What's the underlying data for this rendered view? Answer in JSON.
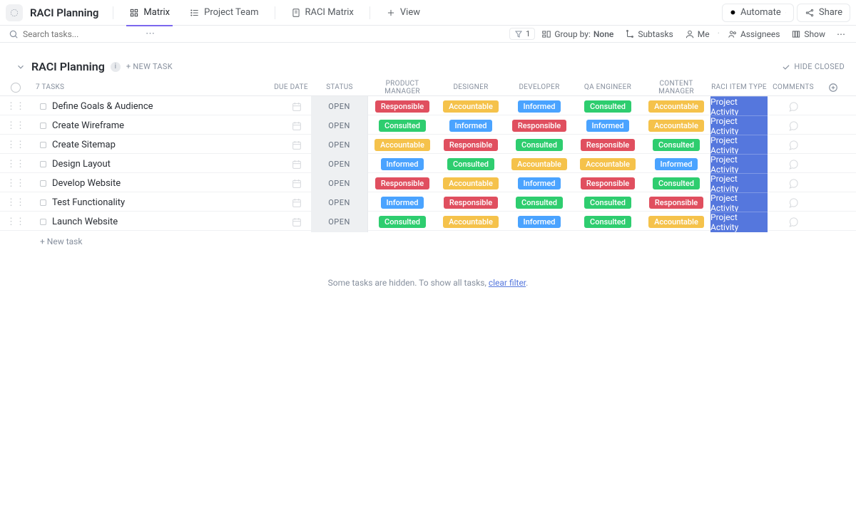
{
  "header": {
    "title": "RACI Planning",
    "tabs": [
      {
        "label": "Matrix",
        "icon": "matrix"
      },
      {
        "label": "Project Team",
        "icon": "team"
      },
      {
        "label": "RACI Matrix",
        "icon": "doc"
      }
    ],
    "view_label": "View",
    "automate_label": "Automate",
    "share_label": "Share"
  },
  "toolbar": {
    "search_placeholder": "Search tasks...",
    "filter_count": "1",
    "group_by_label": "Group by:",
    "group_by_value": "None",
    "subtasks": "Subtasks",
    "me": "Me",
    "assignees": "Assignees",
    "show": "Show"
  },
  "group": {
    "title": "RACI Planning",
    "new_task_label": "+ NEW TASK",
    "hide_closed": "HIDE CLOSED",
    "count_label": "7 TASKS"
  },
  "columns": [
    "DUE DATE",
    "STATUS",
    "PRODUCT MANAGER",
    "DESIGNER",
    "DEVELOPER",
    "QA ENGINEER",
    "CONTENT MANAGER",
    "RACI ITEM TYPE",
    "COMMENTS"
  ],
  "rows": [
    {
      "name": "Define Goals & Audience",
      "status": "OPEN",
      "pm": "Responsible",
      "designer": "Accountable",
      "dev": "Informed",
      "qa": "Consulted",
      "cm": "Accountable",
      "type": "Project Activity"
    },
    {
      "name": "Create Wireframe",
      "status": "OPEN",
      "pm": "Consulted",
      "designer": "Informed",
      "dev": "Responsible",
      "qa": "Informed",
      "cm": "Accountable",
      "type": "Project Activity"
    },
    {
      "name": "Create Sitemap",
      "status": "OPEN",
      "pm": "Accountable",
      "designer": "Responsible",
      "dev": "Consulted",
      "qa": "Responsible",
      "cm": "Consulted",
      "type": "Project Activity"
    },
    {
      "name": "Design Layout",
      "status": "OPEN",
      "pm": "Informed",
      "designer": "Consulted",
      "dev": "Accountable",
      "qa": "Accountable",
      "cm": "Informed",
      "type": "Project Activity"
    },
    {
      "name": "Develop Website",
      "status": "OPEN",
      "pm": "Responsible",
      "designer": "Accountable",
      "dev": "Informed",
      "qa": "Responsible",
      "cm": "Consulted",
      "type": "Project Activity"
    },
    {
      "name": "Test Functionality",
      "status": "OPEN",
      "pm": "Informed",
      "designer": "Responsible",
      "dev": "Consulted",
      "qa": "Consulted",
      "cm": "Responsible",
      "type": "Project Activity"
    },
    {
      "name": "Launch Website",
      "status": "OPEN",
      "pm": "Consulted",
      "designer": "Accountable",
      "dev": "Informed",
      "qa": "Consulted",
      "cm": "Accountable",
      "type": "Project Activity"
    }
  ],
  "footer": {
    "new_task": "+ New task",
    "hidden_prefix": "Some tasks are hidden. To show all tasks, ",
    "hidden_link": "clear filter",
    "hidden_suffix": "."
  }
}
